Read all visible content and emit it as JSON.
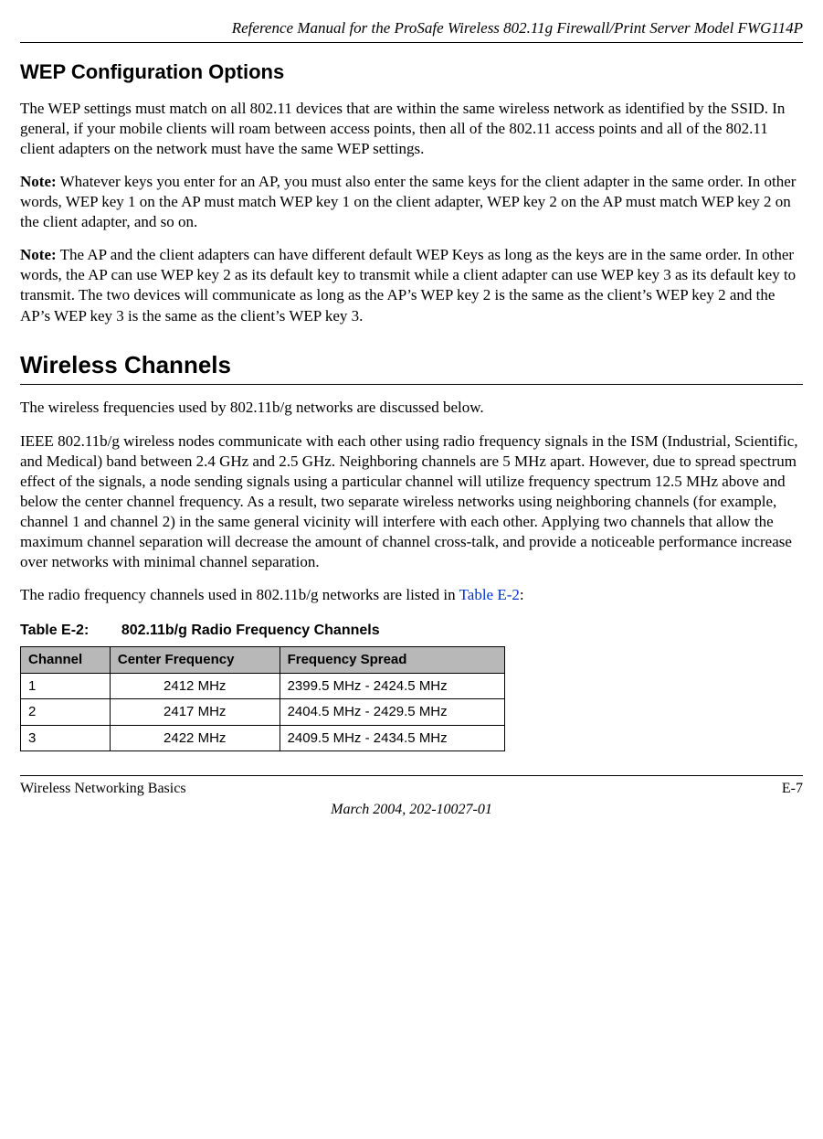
{
  "header": {
    "title": "Reference Manual for the ProSafe Wireless 802.11g  Firewall/Print Server Model FWG114P"
  },
  "sections": {
    "wep_title": "WEP Configuration Options",
    "wep_p1": "The WEP settings must match on all 802.11 devices that are within the same wireless network as identified by the SSID. In general, if your mobile clients will roam between access points, then all of the 802.11 access points and all of the 802.11 client adapters on the network must have the same WEP settings.",
    "note_label": "Note:",
    "wep_note1": " Whatever keys you enter for an AP, you must also enter the same keys for the client adapter in the same order. In other words, WEP key 1 on the AP must match WEP key 1 on the client adapter, WEP key 2 on the AP must match WEP key 2 on the client adapter, and so on.",
    "wep_note2": " The AP and the client adapters can have different default WEP Keys as long as the keys are in the same order. In other words, the AP can use WEP key 2 as its default key to transmit while a client adapter can use WEP key 3 as its default key to transmit. The two devices will communicate as long as the AP’s WEP key 2 is the same as the client’s WEP key 2 and the AP’s WEP key 3 is the same as the client’s WEP key 3.",
    "channels_title": "Wireless Channels",
    "channels_p1": "The wireless frequencies used by 802.11b/g networks are discussed below.",
    "channels_p2": "IEEE 802.11b/g wireless nodes communicate with each other using radio frequency signals in the ISM (Industrial, Scientific, and Medical) band between 2.4 GHz and 2.5 GHz. Neighboring channels are 5 MHz apart. However, due to spread spectrum effect of the signals, a node sending signals using a particular channel will utilize frequency spectrum 12.5 MHz above and below the center channel frequency. As a result, two separate wireless networks using neighboring channels (for example, channel 1 and channel 2) in the same general vicinity will interfere with each other. Applying two channels that allow the maximum channel separation will decrease the amount of channel cross-talk, and provide a noticeable performance increase over networks with minimal channel separation.",
    "channels_p3_pre": "The radio frequency channels used in 802.11b/g networks are listed in ",
    "channels_p3_link": "Table E-2",
    "channels_p3_post": ":"
  },
  "table": {
    "caption_prefix": "Table E-2:",
    "caption_text": "802.11b/g Radio Frequency Channels",
    "headers": {
      "c1": "Channel",
      "c2": "Center Frequency",
      "c3": "Frequency Spread"
    },
    "rows": [
      {
        "c1": "1",
        "c2": "2412 MHz",
        "c3": "2399.5 MHz - 2424.5 MHz"
      },
      {
        "c1": "2",
        "c2": "2417 MHz",
        "c3": "2404.5 MHz - 2429.5 MHz"
      },
      {
        "c1": "3",
        "c2": "2422 MHz",
        "c3": "2409.5 MHz - 2434.5 MHz"
      }
    ]
  },
  "footer": {
    "left": "Wireless Networking Basics",
    "right": "E-7",
    "date": "March 2004, 202-10027-01"
  },
  "chart_data": {
    "type": "table",
    "title": "802.11b/g Radio Frequency Channels",
    "columns": [
      "Channel",
      "Center Frequency",
      "Frequency Spread"
    ],
    "rows": [
      [
        "1",
        "2412 MHz",
        "2399.5 MHz - 2424.5 MHz"
      ],
      [
        "2",
        "2417 MHz",
        "2404.5 MHz - 2429.5 MHz"
      ],
      [
        "3",
        "2422 MHz",
        "2409.5 MHz - 2434.5 MHz"
      ]
    ]
  }
}
